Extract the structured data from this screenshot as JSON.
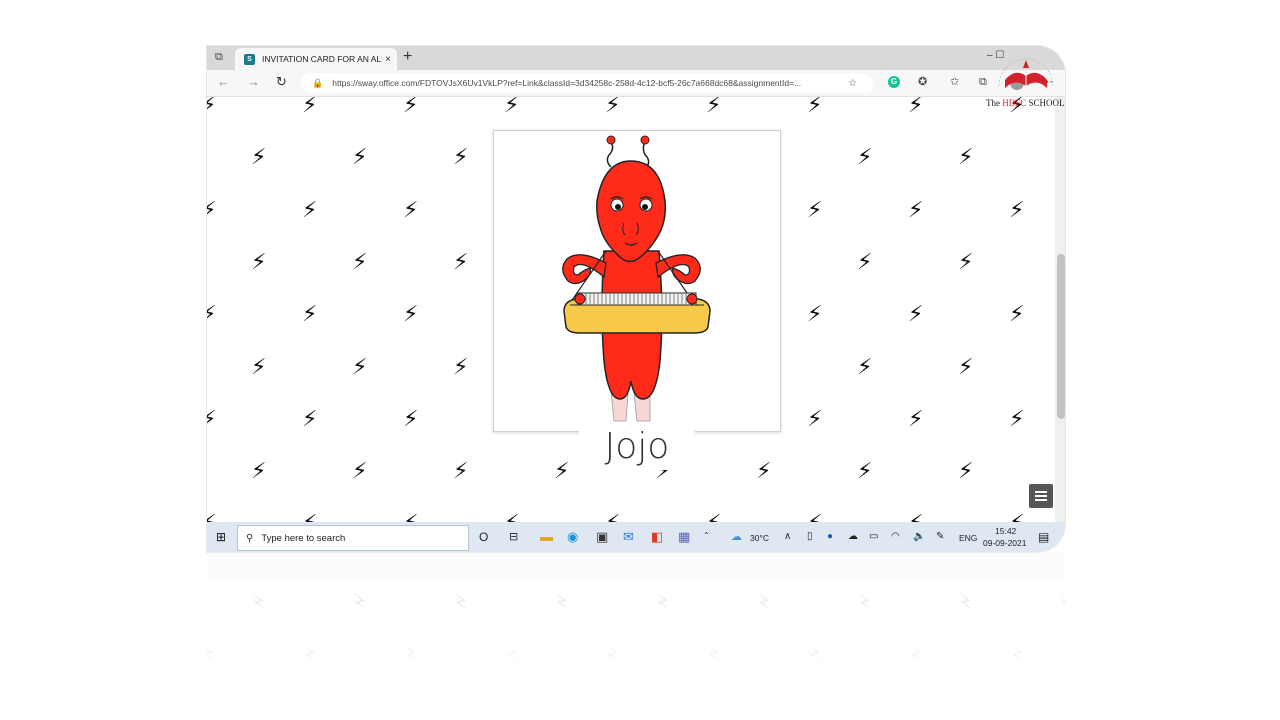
{
  "browser": {
    "tab_title": "INVITATION CARD FOR AN ALIE",
    "tab_close": "×",
    "new_tab": "+",
    "url": "https://sway.office.com/FDTOVJsX6Uv1VkLP?ref=Link&classId=3d34258c-258d-4c12-bcf5-26c7a668dc68&assignmentId=...",
    "window_controls": "–  ☐"
  },
  "toolbar_icons": [
    "back-icon",
    "forward-icon",
    "refresh-icon",
    "lock-icon",
    "favorite-add-icon",
    "grammarly-icon",
    "extensions-icon",
    "favorites-icon",
    "collections-icon",
    "profile-icon",
    "more-icon"
  ],
  "content": {
    "character_name": "Jojo",
    "bolt_glyph": "⚡",
    "colors": {
      "alien_body": "#ff2a1a",
      "keyboard": "#f6c94a",
      "background": "#ffffff",
      "pattern": "#111111"
    }
  },
  "taskbar": {
    "search_placeholder": "Type here to search",
    "temperature": "30°C",
    "language": "ENG",
    "time": "15:42",
    "date": "09-09-2021",
    "taskview_glyph": "O"
  },
  "logo": {
    "prefix": "The",
    "name": "HDFC",
    "suffix": "SCHOOL"
  }
}
